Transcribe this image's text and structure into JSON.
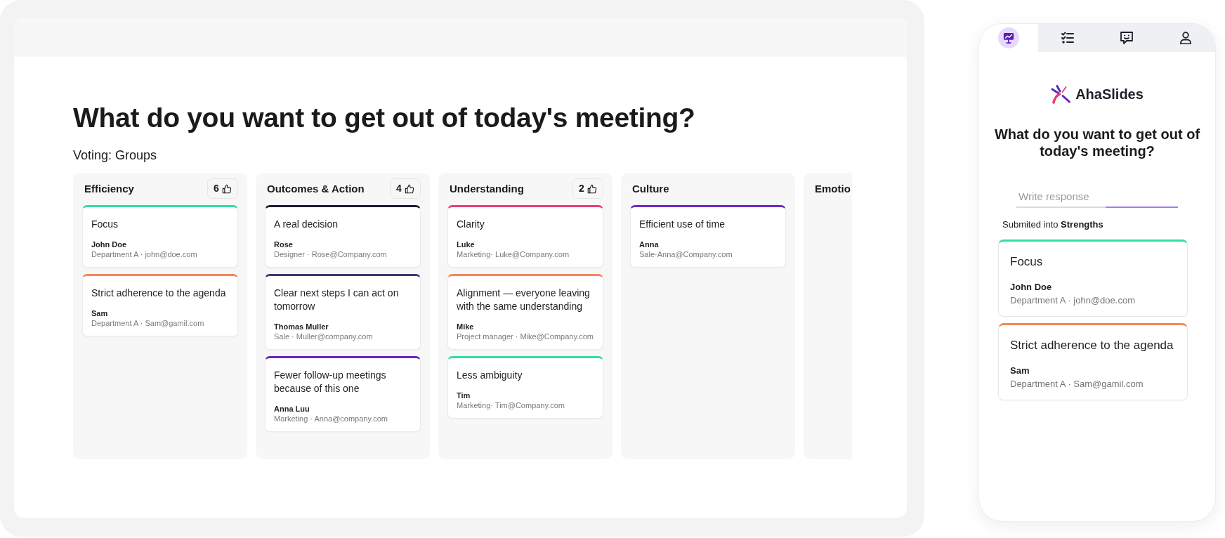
{
  "board": {
    "title": "What do you want to get out of today's meeting?",
    "subtitle": "Voting: Groups",
    "columns": [
      {
        "name": "Efficiency",
        "votes": "6",
        "cards": [
          {
            "text": "Focus",
            "author": "John Doe",
            "details": "Department A · john@doe.com",
            "color": "#34dba9"
          },
          {
            "text": "Strict adherence to the agenda",
            "author": "Sam",
            "details": "Department A · Sam@gamil.com",
            "color": "#f08a5d"
          }
        ]
      },
      {
        "name": "Outcomes & Action",
        "votes": "4",
        "cards": [
          {
            "text": "A real decision",
            "author": "Rose",
            "details": "Designer · Rose@Company.com",
            "color": "#1c1a33"
          },
          {
            "text": "Clear next steps I can act on tomorrow",
            "author": "Thomas Muller",
            "details": "Sale · Muller@company.com",
            "color": "#3d3a6b"
          },
          {
            "text": "Fewer follow-up meetings because of this one",
            "author": "Anna Luu",
            "details": "Marketing · Anna@company.com",
            "color": "#6a24c0"
          }
        ]
      },
      {
        "name": "Understanding",
        "votes": "2",
        "cards": [
          {
            "text": "Clarity",
            "author": "Luke",
            "details": "Marketing· Luke@Company.com",
            "color": "#ea3c6d"
          },
          {
            "text": "Alignment — everyone leaving with the same understanding",
            "author": "Mike",
            "details": "Project manager · Mike@Company.com",
            "color": "#f08a5d"
          },
          {
            "text": "Less ambiguity",
            "author": "Tim",
            "details": "Marketing· Tim@Company.com",
            "color": "#34dba9"
          }
        ]
      },
      {
        "name": "Culture",
        "cards": [
          {
            "text": "Efficient use of time",
            "author": "Anna",
            "details": "Sale·Anna@Company.com",
            "color": "#6a2bc4"
          }
        ]
      },
      {
        "name": "Emotio"
      }
    ]
  },
  "phone": {
    "tabs": [
      {
        "selected": true
      },
      {
        "selected": false
      },
      {
        "selected": false
      },
      {
        "selected": false
      }
    ],
    "logo": "AhaSlides",
    "question": "What do you want to get out of today's meeting?",
    "input": {
      "placeholder": "Write response"
    },
    "note": "Submited into **Strengths**",
    "cards": [
      {
        "text": "Focus",
        "author": "John Doe",
        "details": "Department A · john@doe.com",
        "color": "#34dba9"
      },
      {
        "text": "Strict adherence to the agenda",
        "author": "Sam",
        "details": "Department A · Sam@gamil.com",
        "color": "#f08a5d"
      }
    ]
  }
}
